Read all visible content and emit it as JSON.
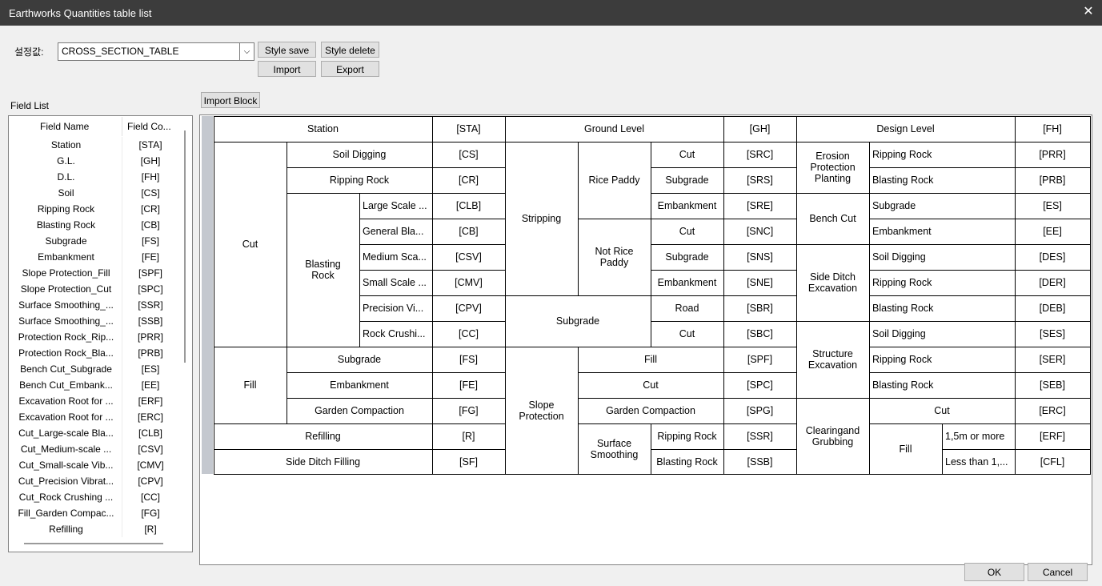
{
  "window": {
    "title": "Earthworks Quantities table list",
    "close_glyph": "✕"
  },
  "settings": {
    "label": "설정값:",
    "combo_value": "CROSS_SECTION_TABLE",
    "combo_arrow": "⌵",
    "style_save": "Style save",
    "style_delete": "Style delete",
    "import": "Import",
    "export": "Export",
    "import_block": "Import Block"
  },
  "field_list": {
    "label": "Field List",
    "headers": {
      "name": "Field Name",
      "code": "Field Co..."
    },
    "rows": [
      {
        "name": "Station",
        "code": "[STA]"
      },
      {
        "name": "G.L.",
        "code": "[GH]"
      },
      {
        "name": "D.L.",
        "code": "[FH]"
      },
      {
        "name": "Soil",
        "code": "[CS]"
      },
      {
        "name": "Ripping Rock",
        "code": "[CR]"
      },
      {
        "name": "Blasting Rock",
        "code": "[CB]"
      },
      {
        "name": "Subgrade",
        "code": "[FS]"
      },
      {
        "name": "Embankment",
        "code": "[FE]"
      },
      {
        "name": "Slope Protection_Fill",
        "code": "[SPF]"
      },
      {
        "name": "Slope Protection_Cut",
        "code": "[SPC]"
      },
      {
        "name": "Surface Smoothing_...",
        "code": "[SSR]"
      },
      {
        "name": "Surface Smoothing_...",
        "code": "[SSB]"
      },
      {
        "name": "Protection Rock_Rip...",
        "code": "[PRR]"
      },
      {
        "name": "Protection Rock_Bla...",
        "code": "[PRB]"
      },
      {
        "name": "Bench Cut_Subgrade",
        "code": "[ES]"
      },
      {
        "name": "Bench Cut_Embank...",
        "code": "[EE]"
      },
      {
        "name": "Excavation Root for ...",
        "code": "[ERF]"
      },
      {
        "name": "Excavation Root for ...",
        "code": "[ERC]"
      },
      {
        "name": "Cut_Large-scale Bla...",
        "code": "[CLB]"
      },
      {
        "name": "Cut_Medium-scale ...",
        "code": "[CSV]"
      },
      {
        "name": "Cut_Small-scale Vib...",
        "code": "[CMV]"
      },
      {
        "name": "Cut_Precision Vibrat...",
        "code": "[CPV]"
      },
      {
        "name": "Cut_Rock Crushing ...",
        "code": "[CC]"
      },
      {
        "name": "Fill_Garden Compac...",
        "code": "[FG]"
      },
      {
        "name": "Refilling",
        "code": "[R]"
      }
    ]
  },
  "table": {
    "c": [
      "Station",
      "[STA]",
      "Ground Level",
      "[GH]",
      "Design Level",
      "[FH]",
      "Cut",
      "Soil Digging",
      "[CS]",
      "Stripping",
      "Rice Paddy",
      "Cut",
      "[SRC]",
      "Erosion\nProtection\nPlanting",
      "Ripping Rock",
      "[PRR]",
      "Ripping Rock",
      "[CR]",
      "Subgrade",
      "[SRS]",
      "Blasting Rock",
      "[PRB]",
      "Blasting\nRock",
      "Large Scale ...",
      "[CLB]",
      "Embankment",
      "[SRE]",
      "Bench Cut",
      "Subgrade",
      "[ES]",
      "General Bla...",
      "[CB]",
      "Not Rice\nPaddy",
      "Cut",
      "[SNC]",
      "Embankment",
      "[EE]",
      "Medium Sca...",
      "[CSV]",
      "Subgrade",
      "[SNS]",
      "Side Ditch\nExcavation",
      "Soil Digging",
      "[DES]",
      "Small Scale ...",
      "[CMV]",
      "Embankment",
      "[SNE]",
      "Ripping Rock",
      "[DER]",
      "Precision Vi...",
      "[CPV]",
      "Subgrade",
      "Road",
      "[SBR]",
      "Blasting Rock",
      "[DEB]",
      "Rock Crushi...",
      "[CC]",
      "Cut",
      "[SBC]",
      "Structure\nExcavation",
      "Soil Digging",
      "[SES]",
      "Fill",
      "Subgrade",
      "[FS]",
      "Slope\nProtection",
      "Fill",
      "[SPF]",
      "Ripping Rock",
      "[SER]",
      "Embankment",
      "[FE]",
      "Cut",
      "[SPC]",
      "Blasting Rock",
      "[SEB]",
      "Garden Compaction",
      "[FG]",
      "Garden Compaction",
      "[SPG]",
      "Clearingand\nGrubbing",
      "Cut",
      "[ERC]",
      "Refilling",
      "[R]",
      "Surface\nSmoothing",
      "Ripping Rock",
      "[SSR]",
      "Fill",
      "1,5m or more",
      "[ERF]",
      "Side Ditch Filling",
      "[SF]",
      "Blasting Rock",
      "[SSB]",
      "Less than 1,...",
      "[CFL]"
    ]
  },
  "footer": {
    "ok": "OK",
    "cancel": "Cancel"
  }
}
